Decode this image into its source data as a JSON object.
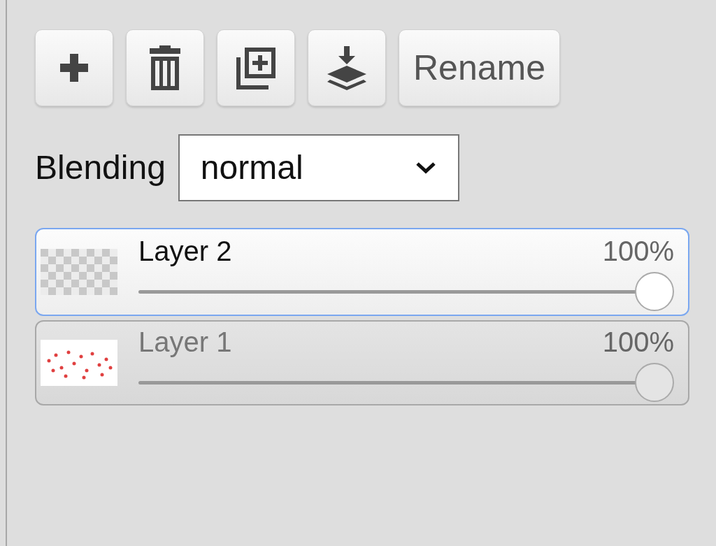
{
  "toolbar": {
    "buttons": [
      {
        "kind": "add"
      },
      {
        "kind": "delete"
      },
      {
        "kind": "duplicate"
      },
      {
        "kind": "merge-down"
      },
      {
        "kind": "text",
        "label": "Rename"
      }
    ]
  },
  "blending": {
    "label": "Blending",
    "value": "normal"
  },
  "layers": [
    {
      "name": "Layer 2",
      "opacity": "100%",
      "level": 1,
      "selected": true,
      "thumbnail": {
        "kind": "transparent"
      }
    },
    {
      "name": "Layer 1",
      "opacity": "100%",
      "level": 1,
      "selected": false
    }
  ]
}
